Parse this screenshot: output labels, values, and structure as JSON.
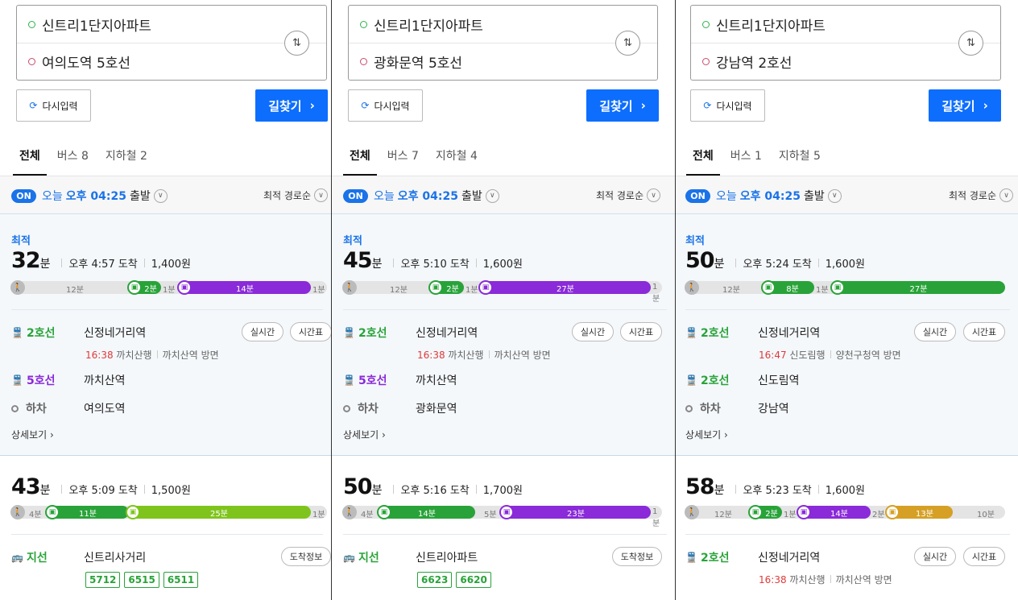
{
  "colors": {
    "green_line": "#29a339",
    "purple_line": "#8a2ad8",
    "lime_bus": "#7fc41c",
    "gold_bus": "#d6a026",
    "blue_accent": "#1a73e8",
    "walk_gray": "#bbbbbb"
  },
  "panels": [
    {
      "origin": "신트리1단지아파트",
      "destination": "여의도역 5호선",
      "reset_label": "다시입력",
      "find_label": "길찾기",
      "tabs": [
        {
          "label": "전체"
        },
        {
          "label": "버스 8"
        },
        {
          "label": "지하철 2"
        }
      ],
      "toggle": "ON",
      "dep_today": "오늘",
      "dep_time": "오후 04:25",
      "dep_suffix": "출발",
      "sort_label": "최적 경로순",
      "route1": {
        "badge": "최적",
        "minutes": "32",
        "unit": "분",
        "arrive": "오후 4:57 도착",
        "fare": "1,400원",
        "tl": {
          "walk1": "12분",
          "seg1": "2분",
          "gap": "1분",
          "seg2": "14분",
          "end": "1분",
          "seg1_color": "#29a339",
          "seg2_color": "#8a2ad8"
        },
        "steps": [
          {
            "line": "2호선",
            "station": "신정네거리역",
            "color": "#29a339",
            "icon": "subway-icon"
          },
          {
            "line": "5호선",
            "station": "까치산역",
            "color": "#8a2ad8",
            "icon": "subway-icon"
          },
          {
            "line": "하차",
            "station": "여의도역",
            "color": "#666",
            "icon": "hollow-circle-icon"
          }
        ],
        "sub_time": "16:38",
        "sub_dir1": "까치산행",
        "sub_dir2": "까치산역 방면",
        "btn1": "실시간",
        "btn2": "시간표",
        "detail": "상세보기"
      },
      "route2": {
        "minutes": "43",
        "unit": "분",
        "arrive": "오후 5:09 도착",
        "fare": "1,500원",
        "tl": {
          "walk1": "4분",
          "seg1": "11분",
          "seg2": "25분",
          "end": "1분",
          "seg1_color": "#29a339",
          "seg2_color": "#7fc41c"
        },
        "step_line": "지선",
        "step_station": "신트리사거리",
        "step_btn": "도착정보",
        "buses": [
          "5712",
          "6515",
          "6511"
        ]
      }
    },
    {
      "origin": "신트리1단지아파트",
      "destination": "광화문역 5호선",
      "reset_label": "다시입력",
      "find_label": "길찾기",
      "tabs": [
        {
          "label": "전체"
        },
        {
          "label": "버스 7"
        },
        {
          "label": "지하철 4"
        }
      ],
      "toggle": "ON",
      "dep_today": "오늘",
      "dep_time": "오후 04:25",
      "dep_suffix": "출발",
      "sort_label": "최적 경로순",
      "route1": {
        "badge": "최적",
        "minutes": "45",
        "unit": "분",
        "arrive": "오후 5:10 도착",
        "fare": "1,600원",
        "tl": {
          "walk1": "12분",
          "seg1": "2분",
          "gap": "1분",
          "seg2": "27분",
          "end": "1분",
          "seg1_color": "#29a339",
          "seg2_color": "#8a2ad8"
        },
        "steps": [
          {
            "line": "2호선",
            "station": "신정네거리역",
            "color": "#29a339",
            "icon": "subway-icon"
          },
          {
            "line": "5호선",
            "station": "까치산역",
            "color": "#8a2ad8",
            "icon": "subway-icon"
          },
          {
            "line": "하차",
            "station": "광화문역",
            "color": "#666",
            "icon": "hollow-circle-icon"
          }
        ],
        "sub_time": "16:38",
        "sub_dir1": "까치산행",
        "sub_dir2": "까치산역 방면",
        "btn1": "실시간",
        "btn2": "시간표",
        "detail": "상세보기"
      },
      "route2": {
        "minutes": "50",
        "unit": "분",
        "arrive": "오후 5:16 도착",
        "fare": "1,700원",
        "tl": {
          "walk1": "4분",
          "seg1": "14분",
          "gap": "5분",
          "seg2": "23분",
          "end": "1분",
          "seg1_color": "#29a339",
          "seg2_color": "#8a2ad8"
        },
        "step_line": "지선",
        "step_station": "신트리아파트",
        "step_btn": "도착정보",
        "buses": [
          "6623",
          "6620"
        ]
      }
    },
    {
      "origin": "신트리1단지아파트",
      "destination": "강남역 2호선",
      "reset_label": "다시입력",
      "find_label": "길찾기",
      "tabs": [
        {
          "label": "전체"
        },
        {
          "label": "버스 1"
        },
        {
          "label": "지하철 5"
        }
      ],
      "toggle": "ON",
      "dep_today": "오늘",
      "dep_time": "오후 04:25",
      "dep_suffix": "출발",
      "sort_label": "최적 경로순",
      "route1": {
        "badge": "최적",
        "minutes": "50",
        "unit": "분",
        "arrive": "오후 5:24 도착",
        "fare": "1,600원",
        "tl": {
          "walk1": "12분",
          "seg1": "8분",
          "gap": "1분",
          "seg2": "27분",
          "end": "",
          "seg1_color": "#29a339",
          "seg2_color": "#29a339"
        },
        "steps": [
          {
            "line": "2호선",
            "station": "신정네거리역",
            "color": "#29a339",
            "icon": "subway-icon"
          },
          {
            "line": "2호선",
            "station": "신도림역",
            "color": "#29a339",
            "icon": "subway-icon"
          },
          {
            "line": "하차",
            "station": "강남역",
            "color": "#666",
            "icon": "hollow-circle-icon"
          }
        ],
        "sub_time": "16:47",
        "sub_dir1": "신도림행",
        "sub_dir2": "양천구청역 방면",
        "btn1": "실시간",
        "btn2": "시간표",
        "detail": "상세보기"
      },
      "route2": {
        "minutes": "58",
        "unit": "분",
        "arrive": "오후 5:23 도착",
        "fare": "1,600원",
        "tl3": {
          "walk1": "12분",
          "s1": "2분",
          "g1": "1분",
          "s2": "14분",
          "g2": "2분",
          "s3": "13분",
          "end": "10분"
        },
        "step_line": "2호선",
        "step_station": "신정네거리역",
        "btn1": "실시간",
        "btn2": "시간표",
        "sub_time": "16:38",
        "sub_dir1": "까치산행",
        "sub_dir2": "까치산역 방면"
      }
    }
  ]
}
